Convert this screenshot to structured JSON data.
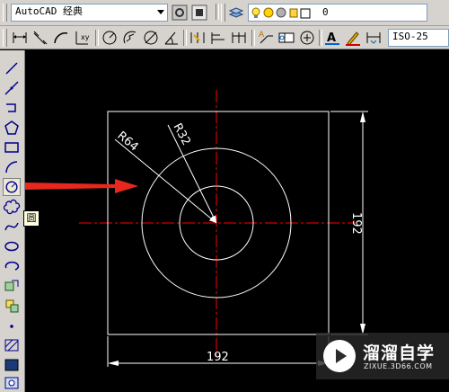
{
  "toolbar_top": {
    "workspace_selected": "AutoCAD 经典",
    "layer_selected": "0"
  },
  "toolbar_dim": {
    "dimstyle_selected": "ISO-25"
  },
  "tooltip": {
    "text": "圆"
  },
  "drawing": {
    "radius_outer_label": "R64",
    "radius_inner_label": "R32",
    "width_label": "192",
    "height_label": "192"
  },
  "watermark": {
    "title": "溜溜自学",
    "url": "ZIXUE.3D66.COM"
  },
  "colors": {
    "background": "#000000",
    "centerline": "#ff0000",
    "geometry": "#ffffff",
    "arrow": "#e8281e",
    "toolbar": "#d6d3ce"
  },
  "icons": {
    "left_toolbar": [
      "line-icon",
      "construction-line-icon",
      "polyline-icon",
      "polygon-icon",
      "rectangle-icon",
      "arc-icon",
      "circle-icon",
      "revision-cloud-icon",
      "spline-icon",
      "ellipse-icon",
      "ellipse-arc-icon",
      "insert-block-icon",
      "make-block-icon",
      "point-icon",
      "hatch-icon",
      "gradient-icon",
      "region-icon"
    ]
  }
}
